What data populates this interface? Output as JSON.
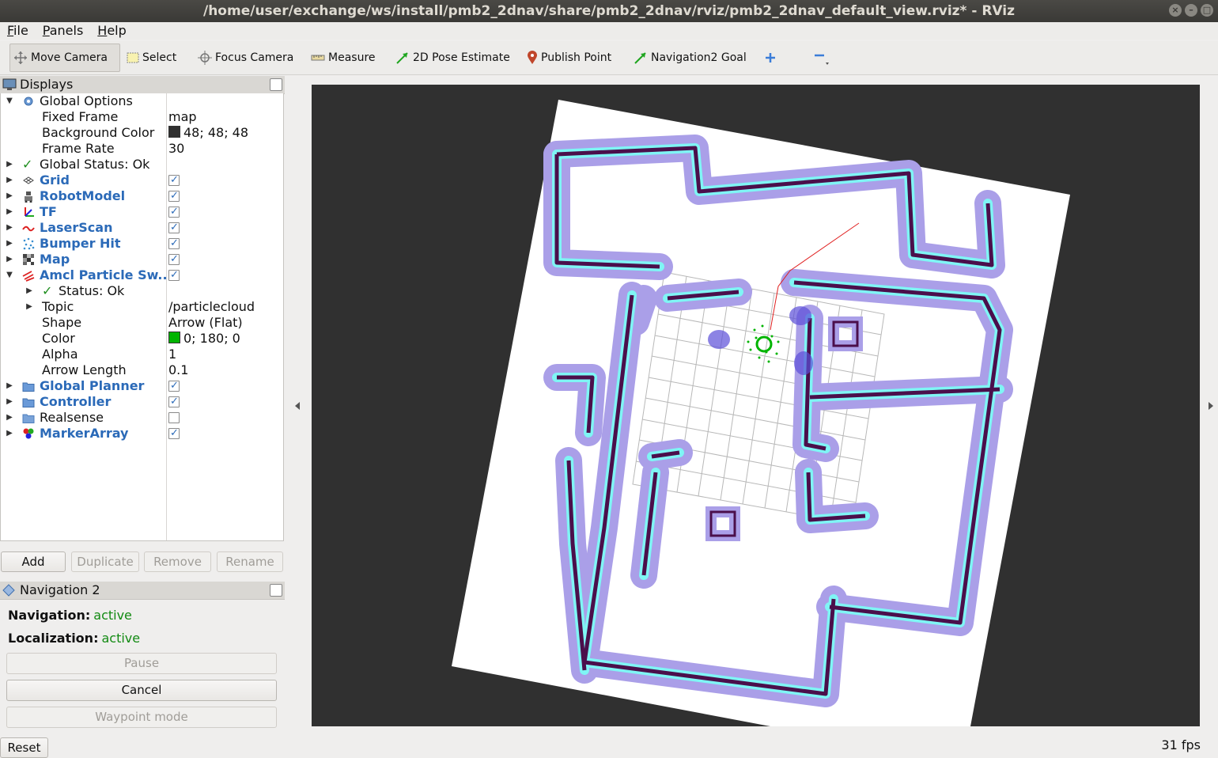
{
  "window": {
    "title": "/home/user/exchange/ws/install/pmb2_2dnav/share/pmb2_2dnav/rviz/pmb2_2dnav_default_view.rviz* - RViz"
  },
  "menu": [
    "File",
    "Panels",
    "Help"
  ],
  "toolbar": {
    "move_camera": "Move Camera",
    "select": "Select",
    "focus_camera": "Focus Camera",
    "measure": "Measure",
    "pose_estimate": "2D Pose Estimate",
    "publish_point": "Publish Point",
    "nav_goal": "Navigation2 Goal"
  },
  "displays": {
    "title": "Displays",
    "global_options": "Global Options",
    "fixed_frame_label": "Fixed Frame",
    "fixed_frame_value": "map",
    "bg_color_label": "Background Color",
    "bg_color_value": "48; 48; 48",
    "frame_rate_label": "Frame Rate",
    "frame_rate_value": "30",
    "global_status": "Global Status: Ok",
    "items": [
      {
        "label": "Grid",
        "checked": true
      },
      {
        "label": "RobotModel",
        "checked": true
      },
      {
        "label": "TF",
        "checked": true
      },
      {
        "label": "LaserScan",
        "checked": true
      },
      {
        "label": "Bumper Hit",
        "checked": true
      },
      {
        "label": "Map",
        "checked": true
      },
      {
        "label": "Amcl Particle Sw...",
        "checked": true
      }
    ],
    "amcl": {
      "status": "Status: Ok",
      "topic_label": "Topic",
      "topic_value": "/particlecloud",
      "shape_label": "Shape",
      "shape_value": "Arrow (Flat)",
      "color_label": "Color",
      "color_value": "0; 180; 0",
      "alpha_label": "Alpha",
      "alpha_value": "1",
      "arrow_length_label": "Arrow Length",
      "arrow_length_value": "0.1"
    },
    "groups": [
      {
        "label": "Global Planner",
        "checked": true,
        "bold": true
      },
      {
        "label": "Controller",
        "checked": true,
        "bold": true
      },
      {
        "label": "Realsense",
        "checked": false,
        "bold": false
      },
      {
        "label": "MarkerArray",
        "checked": true,
        "bold": true
      }
    ],
    "buttons": {
      "add": "Add",
      "duplicate": "Duplicate",
      "remove": "Remove",
      "rename": "Rename"
    }
  },
  "navigation": {
    "title": "Navigation 2",
    "nav_label": "Navigation:",
    "nav_status": "active",
    "loc_label": "Localization:",
    "loc_status": "active",
    "pause": "Pause",
    "cancel": "Cancel",
    "waypoint": "Waypoint mode"
  },
  "status": {
    "reset": "Reset",
    "fps": "31 fps"
  },
  "colors": {
    "background": "#303030",
    "particle": "#00b400",
    "wall": "#4b0f4b",
    "inflation": "#aa9fe8",
    "costmap": "#7ff5f5",
    "accent": "#2b6ab8"
  }
}
